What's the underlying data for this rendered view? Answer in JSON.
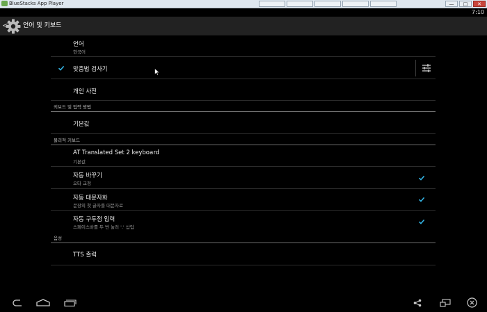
{
  "window": {
    "title": "BlueStacks App Player",
    "controls": [
      "—",
      "□",
      "✕"
    ]
  },
  "status": {
    "time": "7:10"
  },
  "actionbar": {
    "back": "<",
    "title": "언어 및 키보드"
  },
  "rows": {
    "language": {
      "title": "언어",
      "subtitle": "한국어"
    },
    "spellcheck": {
      "title": "맞춤법 검사기",
      "checked": true
    },
    "dictionary": {
      "title": "개인 사전"
    },
    "section_keyboard": "키보드 및 입력 방법",
    "default": {
      "title": "기본값"
    },
    "section_physical": "물리적 키보드",
    "at_keyboard": {
      "title": "AT Translated Set 2 keyboard",
      "subtitle": "기본값"
    },
    "auto_replace": {
      "title": "자동 바꾸기",
      "subtitle": "오타 교정",
      "checked": true
    },
    "auto_cap": {
      "title": "자동 대문자화",
      "subtitle": "문장의 첫 글자를 대문자로",
      "checked": true
    },
    "auto_punct": {
      "title": "자동 구두점 입력",
      "subtitle": "스페이스바를 두 번 눌러 '.' 삽입",
      "checked": true
    },
    "section_voice": "음성",
    "tts": {
      "title": "TTS 출력"
    }
  },
  "colors": {
    "accent": "#33b5e5",
    "actionbar": "#222222",
    "divider": "#2c2c2c"
  }
}
